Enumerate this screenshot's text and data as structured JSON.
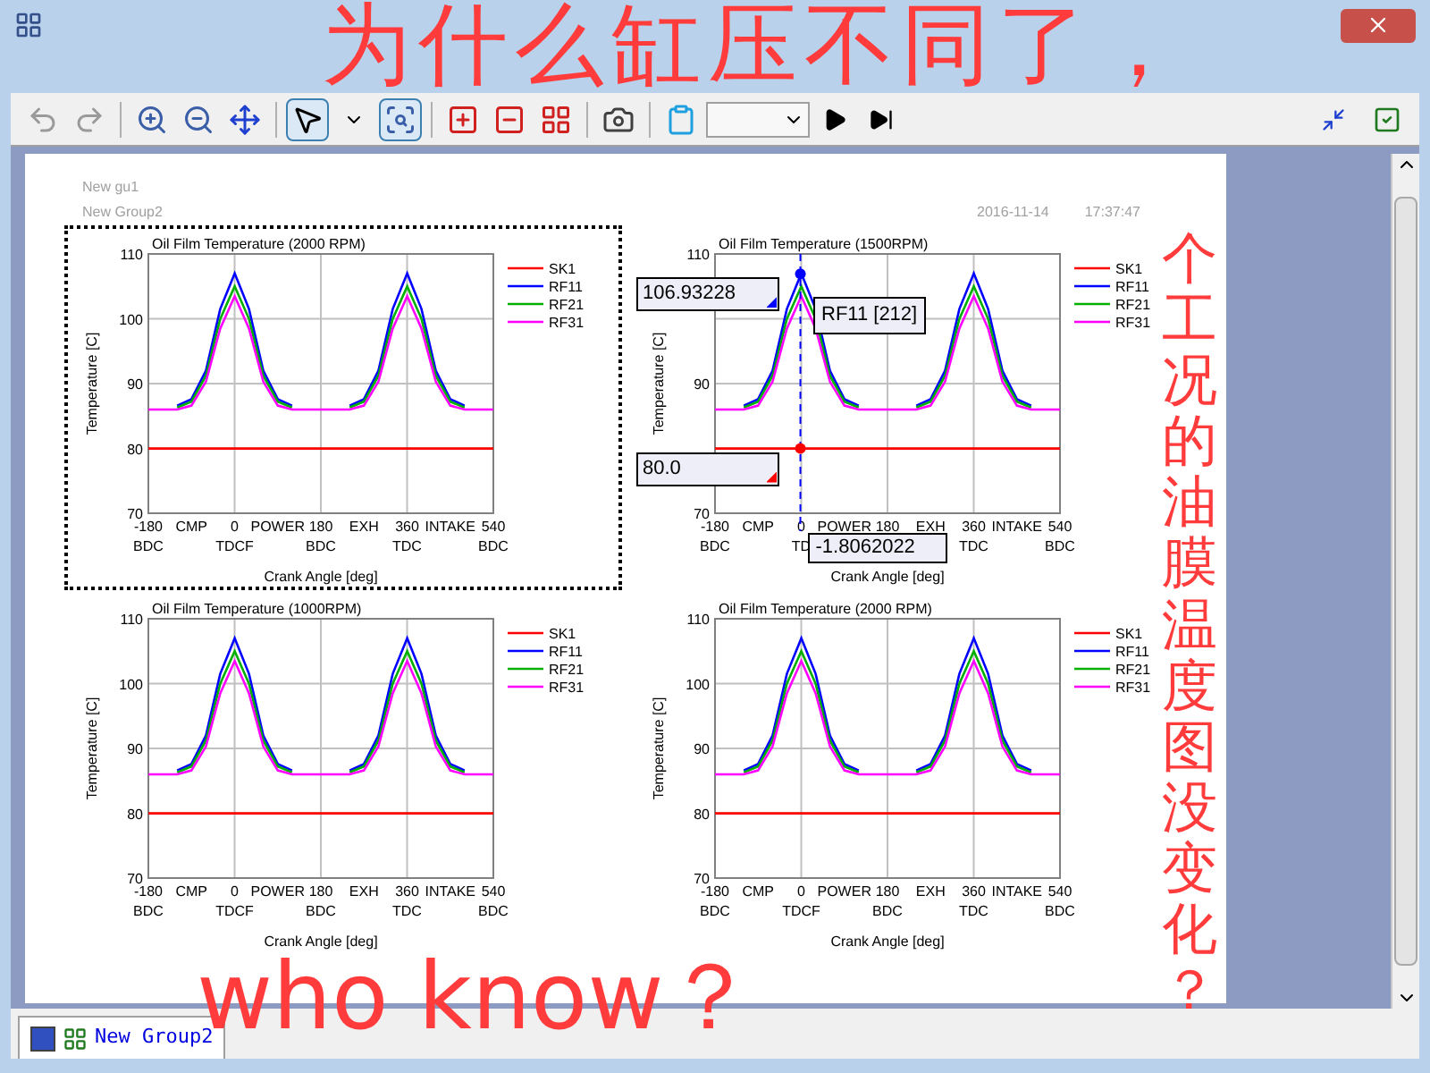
{
  "page": {
    "group_names": [
      "New gu1",
      "New Group2"
    ],
    "date": "2016-11-14",
    "time": "17:37:47"
  },
  "charts": [
    {
      "selected": true,
      "phase_labels": [
        "CMP",
        "POWER",
        "EXH",
        "INTAKE"
      ],
      "chart_data": {
        "type": "line",
        "title": "Oil Film Temperature (2000 RPM)",
        "xlabel": "Crank Angle [deg]",
        "ylabel": "Temperature [C]",
        "grid": true,
        "legend": true,
        "xlim": [
          -180,
          540
        ],
        "ylim": [
          70,
          110
        ],
        "yticks": [
          70,
          80,
          90,
          100,
          110
        ],
        "xticks": [
          {
            "value": -180,
            "label": "-180\nBDC"
          },
          {
            "value": 0,
            "label": "0\nTDCF"
          },
          {
            "value": 180,
            "label": "180\nBDC"
          },
          {
            "value": 360,
            "label": "360\nTDC"
          },
          {
            "value": 540,
            "label": "540\nBDC"
          }
        ],
        "x": [
          -180,
          -150,
          -120,
          -90,
          -60,
          -30,
          0,
          30,
          60,
          90,
          120,
          150,
          180,
          210,
          240,
          270,
          300,
          330,
          360,
          390,
          420,
          450,
          480,
          510,
          540
        ],
        "series": [
          {
            "name": "SK1",
            "color": "#ff0000",
            "values": [
              80,
              80,
              80,
              80,
              80,
              80,
              80,
              80,
              80,
              80,
              80,
              80,
              80,
              80,
              80,
              80,
              80,
              80,
              80,
              80,
              80,
              80,
              80,
              80,
              80
            ]
          },
          {
            "name": "RF11",
            "color": "#0000ff",
            "values": [
              null,
              null,
              86.6,
              87.6,
              92,
              101.5,
              107,
              101.5,
              92,
              87.6,
              86.6,
              null,
              null,
              null,
              86.6,
              87.6,
              92,
              101.5,
              107,
              101.5,
              92,
              87.6,
              86.6,
              null,
              null
            ]
          },
          {
            "name": "RF21",
            "color": "#00b000",
            "values": [
              null,
              null,
              86.3,
              87.2,
              91.2,
              100,
              105,
              100,
              91.2,
              87.2,
              86.3,
              null,
              null,
              null,
              86.3,
              87.2,
              91.2,
              100,
              105,
              100,
              91.2,
              87.2,
              86.3,
              null,
              null
            ]
          },
          {
            "name": "RF31",
            "color": "#ff00ff",
            "values": [
              86,
              86,
              86,
              86.6,
              90.3,
              98.5,
              103.5,
              98.5,
              90.3,
              86.6,
              86,
              86,
              86,
              86,
              86,
              86.6,
              90.3,
              98.5,
              103.5,
              98.5,
              90.3,
              86.6,
              86,
              86,
              86
            ]
          }
        ]
      }
    },
    {
      "selected": false,
      "phase_labels": [
        "CMP",
        "POWER",
        "EXH",
        "INTAKE"
      ],
      "cursor": {
        "x_readout": "-1.8062022",
        "series_label": "RF11 [212]",
        "readouts": [
          {
            "text": "106.93228",
            "color": "#0000ff"
          },
          {
            "text": "80.0",
            "color": "#ff0000"
          }
        ]
      },
      "chart_data": {
        "type": "line",
        "title": "Oil Film Temperature (1500RPM)",
        "xlabel": "Crank Angle [deg]",
        "ylabel": "Temperature [C]",
        "grid": true,
        "legend": true,
        "xlim": [
          -180,
          540
        ],
        "ylim": [
          70,
          110
        ],
        "yticks": [
          70,
          90,
          110
        ],
        "xticks": [
          {
            "value": -180,
            "label": "-180\nBDC"
          },
          {
            "value": 0,
            "label": "0\nTD"
          },
          {
            "value": 180,
            "label": "180"
          },
          {
            "value": 360,
            "label": "360\nTDC"
          },
          {
            "value": 540,
            "label": "540\nBDC"
          }
        ],
        "x": [
          -180,
          -150,
          -120,
          -90,
          -60,
          -30,
          0,
          30,
          60,
          90,
          120,
          150,
          180,
          210,
          240,
          270,
          300,
          330,
          360,
          390,
          420,
          450,
          480,
          510,
          540
        ],
        "series": [
          {
            "name": "SK1",
            "color": "#ff0000",
            "values": [
              80,
              80,
              80,
              80,
              80,
              80,
              80,
              80,
              80,
              80,
              80,
              80,
              80,
              80,
              80,
              80,
              80,
              80,
              80,
              80,
              80,
              80,
              80,
              80,
              80
            ]
          },
          {
            "name": "RF11",
            "color": "#0000ff",
            "values": [
              null,
              null,
              86.6,
              87.6,
              92,
              101.5,
              107,
              101.5,
              92,
              87.6,
              86.6,
              null,
              null,
              null,
              86.6,
              87.6,
              92,
              101.5,
              107,
              101.5,
              92,
              87.6,
              86.6,
              null,
              null
            ]
          },
          {
            "name": "RF21",
            "color": "#00b000",
            "values": [
              null,
              null,
              86.3,
              87.2,
              91.2,
              100,
              105,
              100,
              91.2,
              87.2,
              86.3,
              null,
              null,
              null,
              86.3,
              87.2,
              91.2,
              100,
              105,
              100,
              91.2,
              87.2,
              86.3,
              null,
              null
            ]
          },
          {
            "name": "RF31",
            "color": "#ff00ff",
            "values": [
              86,
              86,
              86,
              86.6,
              90.3,
              98.5,
              103.5,
              98.5,
              90.3,
              86.6,
              86,
              86,
              86,
              86,
              86,
              86.6,
              90.3,
              98.5,
              103.5,
              98.5,
              90.3,
              86.6,
              86,
              86,
              86
            ]
          }
        ]
      }
    },
    {
      "selected": false,
      "phase_labels": [
        "CMP",
        "POWER",
        "EXH",
        "INTAKE"
      ],
      "chart_data": {
        "type": "line",
        "title": "Oil Film Temperature (1000RPM)",
        "xlabel": "Crank Angle [deg]",
        "ylabel": "Temperature [C]",
        "grid": true,
        "legend": true,
        "xlim": [
          -180,
          540
        ],
        "ylim": [
          70,
          110
        ],
        "yticks": [
          70,
          80,
          90,
          100,
          110
        ],
        "xticks": [
          {
            "value": -180,
            "label": "-180\nBDC"
          },
          {
            "value": 0,
            "label": "0\nTDCF"
          },
          {
            "value": 180,
            "label": "180\nBDC"
          },
          {
            "value": 360,
            "label": "360\nTDC"
          },
          {
            "value": 540,
            "label": "540\nBDC"
          }
        ],
        "x": [
          -180,
          -150,
          -120,
          -90,
          -60,
          -30,
          0,
          30,
          60,
          90,
          120,
          150,
          180,
          210,
          240,
          270,
          300,
          330,
          360,
          390,
          420,
          450,
          480,
          510,
          540
        ],
        "series": [
          {
            "name": "SK1",
            "color": "#ff0000",
            "values": [
              80,
              80,
              80,
              80,
              80,
              80,
              80,
              80,
              80,
              80,
              80,
              80,
              80,
              80,
              80,
              80,
              80,
              80,
              80,
              80,
              80,
              80,
              80,
              80,
              80
            ]
          },
          {
            "name": "RF11",
            "color": "#0000ff",
            "values": [
              null,
              null,
              86.6,
              87.6,
              92,
              101.5,
              107,
              101.5,
              92,
              87.6,
              86.6,
              null,
              null,
              null,
              86.6,
              87.6,
              92,
              101.5,
              107,
              101.5,
              92,
              87.6,
              86.6,
              null,
              null
            ]
          },
          {
            "name": "RF21",
            "color": "#00b000",
            "values": [
              null,
              null,
              86.3,
              87.2,
              91.2,
              100,
              105,
              100,
              91.2,
              87.2,
              86.3,
              null,
              null,
              null,
              86.3,
              87.2,
              91.2,
              100,
              105,
              100,
              91.2,
              87.2,
              86.3,
              null,
              null
            ]
          },
          {
            "name": "RF31",
            "color": "#ff00ff",
            "values": [
              86,
              86,
              86,
              86.6,
              90.3,
              98.5,
              103.5,
              98.5,
              90.3,
              86.6,
              86,
              86,
              86,
              86,
              86,
              86.6,
              90.3,
              98.5,
              103.5,
              98.5,
              90.3,
              86.6,
              86,
              86,
              86
            ]
          }
        ]
      }
    },
    {
      "selected": false,
      "phase_labels": [
        "CMP",
        "POWER",
        "EXH",
        "INTAKE"
      ],
      "chart_data": {
        "type": "line",
        "title": "Oil Film Temperature (2000 RPM)",
        "xlabel": "Crank Angle [deg]",
        "ylabel": "Temperature [C]",
        "grid": true,
        "legend": true,
        "xlim": [
          -180,
          540
        ],
        "ylim": [
          70,
          110
        ],
        "yticks": [
          70,
          80,
          90,
          100,
          110
        ],
        "xticks": [
          {
            "value": -180,
            "label": "-180\nBDC"
          },
          {
            "value": 0,
            "label": "0\nTDCF"
          },
          {
            "value": 180,
            "label": "180\nBDC"
          },
          {
            "value": 360,
            "label": "360\nTDC"
          },
          {
            "value": 540,
            "label": "540\nBDC"
          }
        ],
        "x": [
          -180,
          -150,
          -120,
          -90,
          -60,
          -30,
          0,
          30,
          60,
          90,
          120,
          150,
          180,
          210,
          240,
          270,
          300,
          330,
          360,
          390,
          420,
          450,
          480,
          510,
          540
        ],
        "series": [
          {
            "name": "SK1",
            "color": "#ff0000",
            "values": [
              80,
              80,
              80,
              80,
              80,
              80,
              80,
              80,
              80,
              80,
              80,
              80,
              80,
              80,
              80,
              80,
              80,
              80,
              80,
              80,
              80,
              80,
              80,
              80,
              80
            ]
          },
          {
            "name": "RF11",
            "color": "#0000ff",
            "values": [
              null,
              null,
              86.6,
              87.6,
              92,
              101.5,
              107,
              101.5,
              92,
              87.6,
              86.6,
              null,
              null,
              null,
              86.6,
              87.6,
              92,
              101.5,
              107,
              101.5,
              92,
              87.6,
              86.6,
              null,
              null
            ]
          },
          {
            "name": "RF21",
            "color": "#00b000",
            "values": [
              null,
              null,
              86.3,
              87.2,
              91.2,
              100,
              105,
              100,
              91.2,
              87.2,
              86.3,
              null,
              null,
              null,
              86.3,
              87.2,
              91.2,
              100,
              105,
              100,
              91.2,
              87.2,
              86.3,
              null,
              null
            ]
          },
          {
            "name": "RF31",
            "color": "#ff00ff",
            "values": [
              86,
              86,
              86,
              86.6,
              90.3,
              98.5,
              103.5,
              98.5,
              90.3,
              86.6,
              86,
              86,
              86,
              86,
              86,
              86.6,
              90.3,
              98.5,
              103.5,
              98.5,
              90.3,
              86.6,
              86,
              86,
              86
            ]
          }
        ]
      }
    }
  ],
  "tabs": [
    {
      "label": "New Group2",
      "selected": true
    }
  ],
  "handwritten_notes": [
    {
      "kind": "top",
      "text": "为什么缸压不同了，"
    },
    {
      "kind": "bottom",
      "text": "who know？"
    },
    {
      "kind": "column",
      "text": "个工况的油膜温度图没变化？"
    }
  ]
}
